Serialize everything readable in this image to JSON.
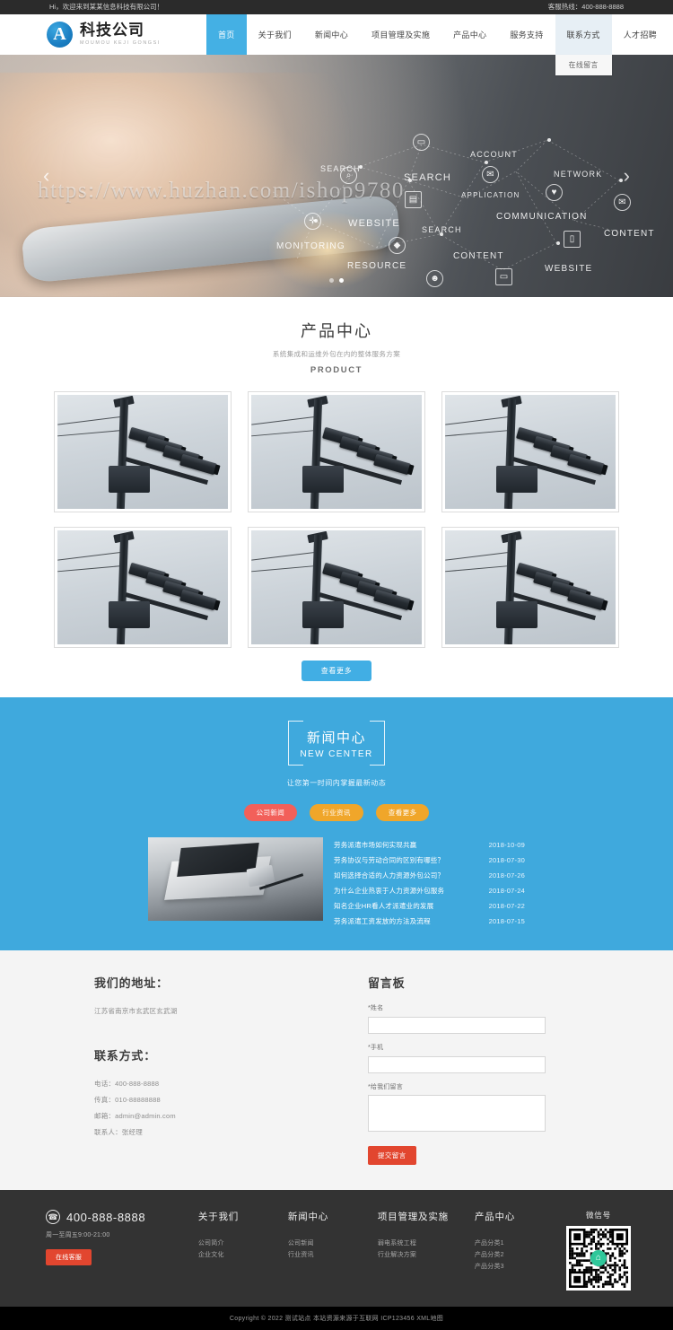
{
  "topbar": {
    "welcome": "Hi，欢迎来到某某信息科技有限公司！",
    "hotline": "客服热线：400-888-8888"
  },
  "header": {
    "logo_cn": "科技公司",
    "logo_en": "MOUMOU KEJI GONGSI",
    "logo_glyph": "A",
    "nav": [
      {
        "label": "首页",
        "state": "active"
      },
      {
        "label": "关于我们",
        "state": ""
      },
      {
        "label": "新闻中心",
        "state": ""
      },
      {
        "label": "项目管理及实施",
        "state": ""
      },
      {
        "label": "产品中心",
        "state": ""
      },
      {
        "label": "服务支持",
        "state": ""
      },
      {
        "label": "联系方式",
        "state": "hover"
      },
      {
        "label": "人才招聘",
        "state": ""
      }
    ],
    "dropdown": {
      "parent": "联系方式",
      "items": [
        "在线留言"
      ]
    }
  },
  "banner": {
    "watermark": "https://www.huzhan.com/ishop9780",
    "prev_arrow": "‹",
    "next_arrow": "›",
    "dots": 2,
    "active_dot": 1,
    "network_words": [
      "SEARCH",
      "ACCOUNT",
      "SEARCH",
      "NETWORK",
      "APPLICATION",
      "COMMUNICATION",
      "WEBSITE",
      "SEARCH",
      "CONTENT",
      "MONITORING",
      "RESOURCE",
      "CONTENT",
      "WEBSITE"
    ]
  },
  "products": {
    "title": "产品中心",
    "subtitle": "系统集成和运维外包在内的整体服务方案",
    "english": "PRODUCT",
    "items": [
      {
        "alt": "监控摄像头"
      },
      {
        "alt": "监控摄像头"
      },
      {
        "alt": "监控摄像头"
      },
      {
        "alt": "监控摄像头"
      },
      {
        "alt": "监控摄像头"
      },
      {
        "alt": "监控摄像头"
      }
    ],
    "more_label": "查看更多"
  },
  "news": {
    "title": "新闻中心",
    "english": "NEW CENTER",
    "slogan": "让您第一时间内掌握最新动态",
    "tabs": [
      {
        "label": "公司新闻",
        "style": "t-red"
      },
      {
        "label": "行业资讯",
        "style": "t-orange"
      },
      {
        "label": "查看更多",
        "style": "t-orange"
      }
    ],
    "items": [
      {
        "title": "劳务派遣市场如何实现共赢",
        "date": "2018-10-09"
      },
      {
        "title": "劳务协议与劳动合同的区别有哪些？",
        "date": "2018-07-30"
      },
      {
        "title": "如何选择合适的人力资源外包公司？",
        "date": "2018-07-26"
      },
      {
        "title": "为什么企业热衷于人力资源外包服务",
        "date": "2018-07-24"
      },
      {
        "title": "知名企业HR看人才派遣业的发展",
        "date": "2018-07-22"
      },
      {
        "title": "劳务派遣工资发放的方法及流程",
        "date": "2018-07-15"
      }
    ]
  },
  "contact": {
    "address_title": "我们的地址：",
    "address": "江苏省南京市玄武区玄武湖",
    "contact_title": "联系方式：",
    "lines": [
      "电话：400-888-8888",
      "传真：010-88888888",
      "邮箱：admin@admin.com",
      "联系人：张经理"
    ]
  },
  "form": {
    "title": "留言板",
    "name_label": "*姓名",
    "name_value": "",
    "phone_label": "*手机",
    "phone_value": "",
    "message_label": "*给我们留言",
    "message_value": "",
    "submit_label": "提交留言"
  },
  "footer": {
    "phone": "400-888-8888",
    "phone_icon": "☎",
    "hours": "周一至周五9:00-21:00",
    "service_button": "在线客服",
    "columns": [
      {
        "title": "关于我们",
        "links": [
          "公司简介",
          "企业文化"
        ]
      },
      {
        "title": "新闻中心",
        "links": [
          "公司新闻",
          "行业资讯"
        ]
      },
      {
        "title": "项目管理及实施",
        "links": [
          "弱电系统工程",
          "行业解决方案"
        ]
      },
      {
        "title": "产品中心",
        "links": [
          "产品分类1",
          "产品分类2",
          "产品分类3"
        ]
      }
    ],
    "qr_label": "微信号",
    "qr_center_icon": "⌂",
    "copyright": "Copyright © 2022 测试站点 本站资源来源于互联网  ICP123456  XML地图"
  },
  "colors": {
    "accent_blue": "#41aee4",
    "news_bg": "#3fa9dd",
    "red": "#e2462f",
    "orange": "#f0a62a",
    "footer_bg": "#333333"
  }
}
